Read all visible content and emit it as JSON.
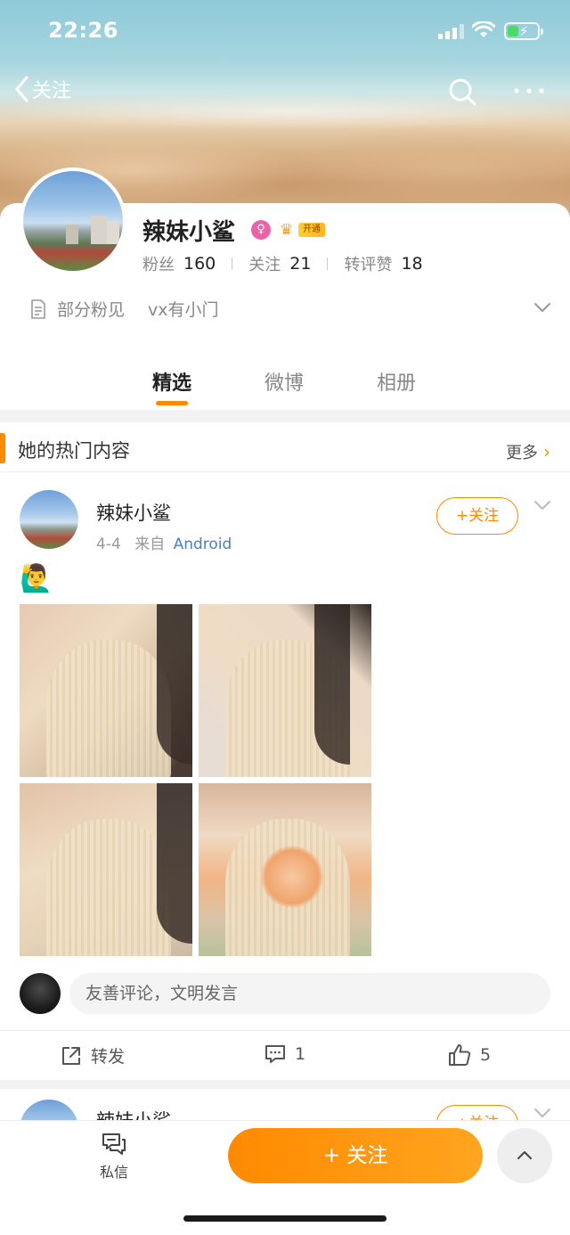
{
  "status_bar": {
    "time": "22:26"
  },
  "nav": {
    "back_label": "关注"
  },
  "profile": {
    "name": "辣妹小鲨",
    "gender_symbol": "♀",
    "vip_label": "开通",
    "stats": [
      {
        "label": "粉丝",
        "value": "160"
      },
      {
        "label": "关注",
        "value": "21"
      },
      {
        "label": "转评赞",
        "value": "18"
      }
    ],
    "visibility": "部分粉见",
    "bio": "vx有小门"
  },
  "tabs": [
    {
      "label": "精选",
      "active": true
    },
    {
      "label": "微博",
      "active": false
    },
    {
      "label": "相册",
      "active": false
    }
  ],
  "hot": {
    "title": "她的热门内容",
    "more_label": "更多"
  },
  "post": {
    "author": "辣妹小鲨",
    "date": "4-4",
    "source_prefix": "来自",
    "source": "Android",
    "follow_label": "+关注",
    "emoji": "🙋‍♂️",
    "comment_placeholder": "友善评论，文明发言",
    "repost_label": "转发",
    "comments_count": "1",
    "likes_count": "5"
  },
  "post2": {
    "author": "辣妹小鲨",
    "follow_label": "+关注"
  },
  "bottom": {
    "dm_label": "私信",
    "follow_label": "+ 关注"
  },
  "colors": {
    "accent": "#ff8a00",
    "link": "#4a7fbf",
    "gender": "#ea63a8"
  }
}
